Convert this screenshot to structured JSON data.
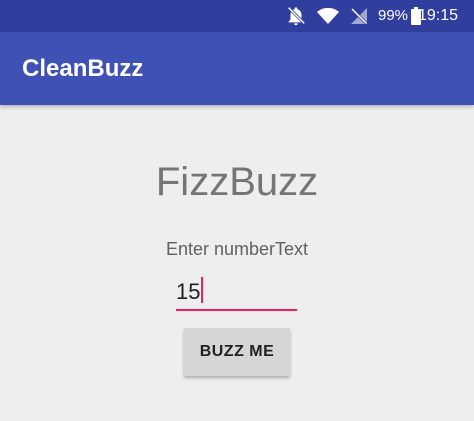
{
  "status_bar": {
    "icons": [
      "notifications-off-icon",
      "wifi-icon",
      "cellular-signal-icon",
      "battery-icon"
    ],
    "battery": "99%",
    "time": "19:15"
  },
  "app_bar": {
    "title": "CleanBuzz",
    "color": "#3f51b5",
    "status_color": "#303f9f"
  },
  "main": {
    "heading": "FizzBuzz",
    "prompt": "Enter numberText",
    "number_input": {
      "value": "15",
      "accent_color": "#e91e63"
    },
    "buzz_button_label": "BUZZ ME"
  }
}
